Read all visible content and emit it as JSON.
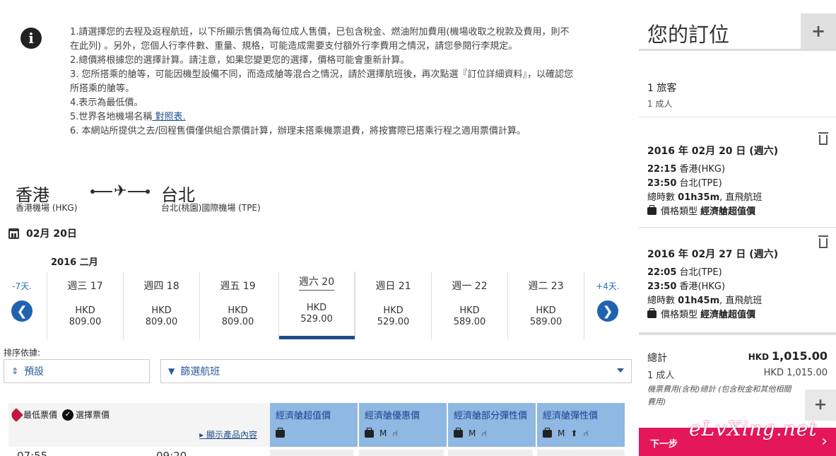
{
  "notice": {
    "lines": [
      "1.請選擇您的去程及返程航班，以下所顯示售價為每位成人售價，已包含稅金、燃油附加費用(機場收取之稅款及費用，則不",
      "在此列) 。另外，您個人行李件數、重量、規格，可能造成需要支付額外行李費用之情況，請您參閱行李規定。",
      "2.總價將根據您的選擇計算。請注意，如果您變更您的選擇，價格可能會重新計算。",
      "3. 您所搭乘的艙等，可能因機型設備不同，而造成艙等混合之情況，請於選擇航班後，再次點選『訂位詳細資料』，以確認您",
      "所搭乘的艙等。",
      "4.表示為最低價。"
    ],
    "line5_prefix": "5.世界各地機場名稱",
    "line5_link": " 對照表.",
    "line6": "6. 本網站所提供之去/回程售價僅供組合票價計算，辦理未搭乘機票退費，將按實際已搭乘行程之適用票價計算。"
  },
  "route": {
    "from_city": "香港",
    "from_airport": "香港機場 (HKG)",
    "to_city": "台北",
    "to_airport": "台北(桃園)國際機場 (TPE)"
  },
  "selected_date": "02月 20日",
  "month_label": "2016 二月",
  "carousel": {
    "prev_label": "-7天.",
    "next_label": "+4天.",
    "days": [
      {
        "name": "週三 17",
        "currency": "HKD",
        "price": "809.00"
      },
      {
        "name": "週四 18",
        "currency": "HKD",
        "price": "809.00"
      },
      {
        "name": "週五 19",
        "currency": "HKD",
        "price": "809.00"
      },
      {
        "name": "週六 20",
        "currency": "HKD",
        "price": "529.00"
      },
      {
        "name": "週日 21",
        "currency": "HKD",
        "price": "529.00"
      },
      {
        "name": "週一 22",
        "currency": "HKD",
        "price": "589.00"
      },
      {
        "name": "週二 23",
        "currency": "HKD",
        "price": "589.00"
      }
    ]
  },
  "sort": {
    "label": "排序依據:",
    "default_label": "預設",
    "filter_label": "篩選航班"
  },
  "fare_table": {
    "legend_lowest": "最低票價",
    "legend_selected": "選擇票價",
    "show_products": "顯示產品內容",
    "columns": [
      "經濟艙超值價",
      "經濟艙優惠價",
      "經濟艙部分彈性價",
      "經濟艙彈性價"
    ],
    "row_times": [
      "07:55",
      "09:20"
    ]
  },
  "booking": {
    "title": "您的訂位",
    "pax_count": "1 旅客",
    "pax_detail": "1 成人",
    "segments": [
      {
        "date": "2016 年 02月 20 日 (週六)",
        "dep": "22:15",
        "dep_city": "香港(HKG)",
        "arr": "23:50",
        "arr_city": "台北(TPE)",
        "duration_label": "總時數",
        "duration": "01h35m",
        "direct": ", 直飛航班",
        "fare_label": "價格類型",
        "fare": "經濟艙超值價"
      },
      {
        "date": "2016 年 02月 27 日 (週六)",
        "dep": "22:05",
        "dep_city": "台北(TPE)",
        "arr": "23:50",
        "arr_city": "香港(HKG)",
        "duration_label": "總時數",
        "duration": "01h45m",
        "direct": ", 直飛航班",
        "fare_label": "價格類型",
        "fare": "經濟艙超值價"
      }
    ],
    "total_label": "總計",
    "total_currency": "HKD",
    "total_amount": "1,015.00",
    "adult_label": "1 成人",
    "adult_amount": "HKD 1,015.00",
    "note": "機票費用(含稅)總計 (包含稅金和其他相關費用)",
    "next_label": "下一步",
    "watermark": "eLvXing.net"
  },
  "colors": {
    "accent_blue": "#1f63b0",
    "header_blue": "#8fb8e2",
    "next_pink": "#e4175a"
  }
}
